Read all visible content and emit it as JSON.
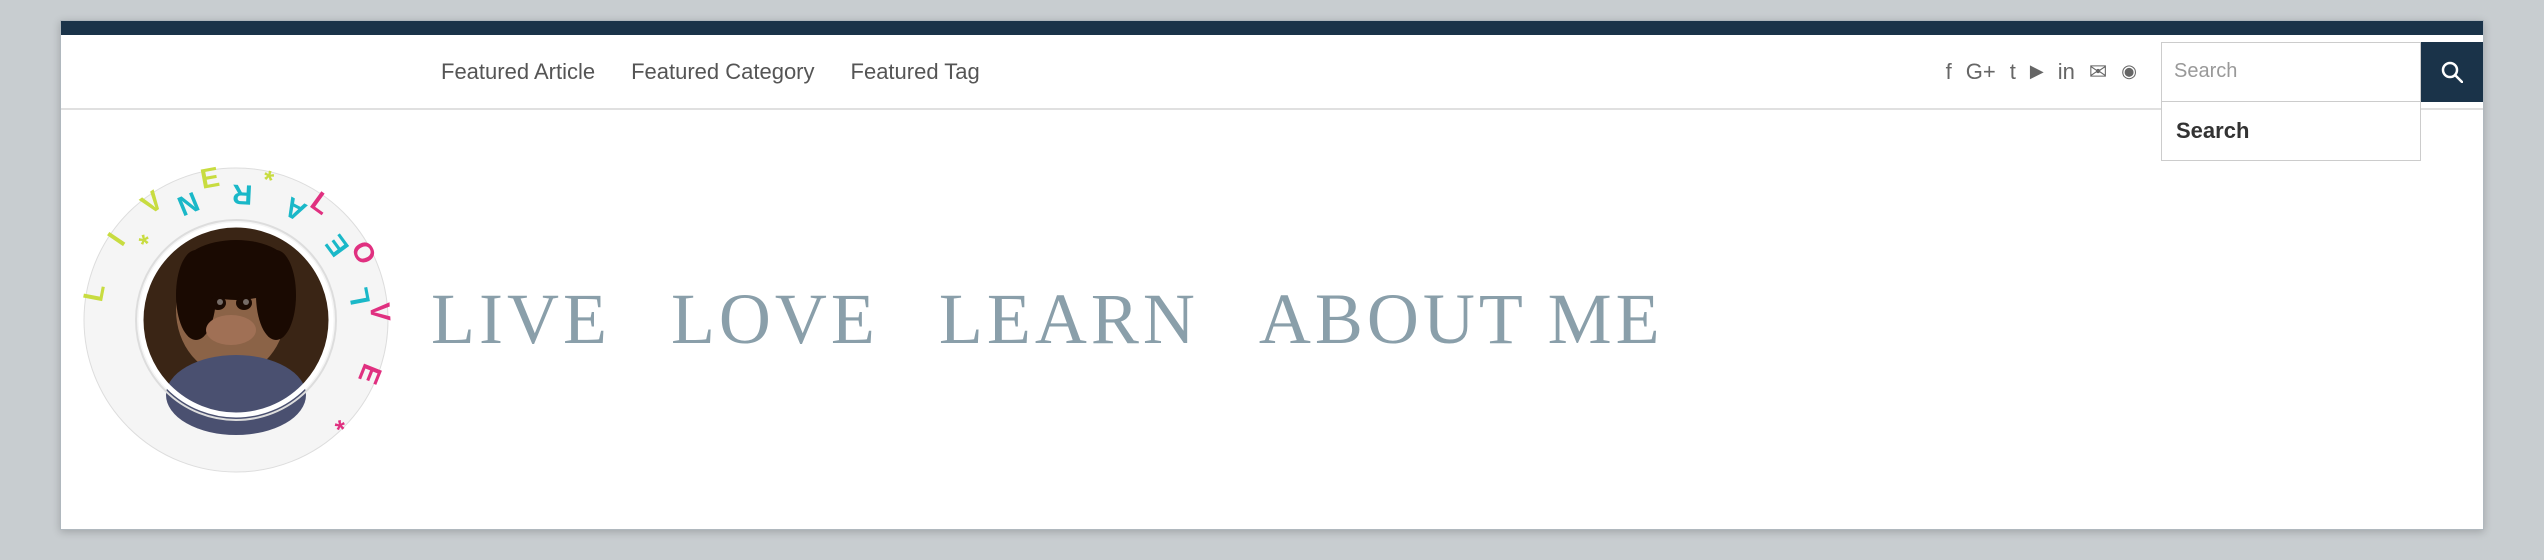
{
  "topBar": {
    "backgroundColor": "#1a3349"
  },
  "nav": {
    "links": [
      {
        "label": "Featured Article",
        "id": "featured-article"
      },
      {
        "label": "Featured Category",
        "id": "featured-category"
      },
      {
        "label": "Featured Tag",
        "id": "featured-tag"
      }
    ],
    "socialIcons": [
      {
        "name": "facebook-icon",
        "symbol": "f"
      },
      {
        "name": "google-plus-icon",
        "symbol": "G+"
      },
      {
        "name": "twitter-icon",
        "symbol": "t"
      },
      {
        "name": "youtube-icon",
        "symbol": "▶"
      },
      {
        "name": "linkedin-icon",
        "symbol": "in"
      },
      {
        "name": "email-icon",
        "symbol": "✉"
      },
      {
        "name": "rss-icon",
        "symbol": "◉"
      }
    ],
    "searchInput": {
      "placeholder": "Search",
      "value": "Search"
    },
    "searchButton": {
      "label": "🔍"
    },
    "searchDropdown": {
      "item": "Search"
    }
  },
  "logo": {
    "topText": [
      "L",
      "I",
      "V",
      "E"
    ],
    "rightText": [
      "L",
      "O",
      "V",
      "E"
    ],
    "bottomText": [
      "N",
      "R",
      "A",
      "E",
      "L"
    ],
    "topColor": "#c8dc40",
    "rightColor": "#e03080",
    "bottomColor": "#1ab8c8",
    "starColor": "#c8dc40"
  },
  "siteNav": {
    "words": [
      "LIVE",
      "LOVE",
      "LEARN",
      "ABOUT ME"
    ]
  }
}
